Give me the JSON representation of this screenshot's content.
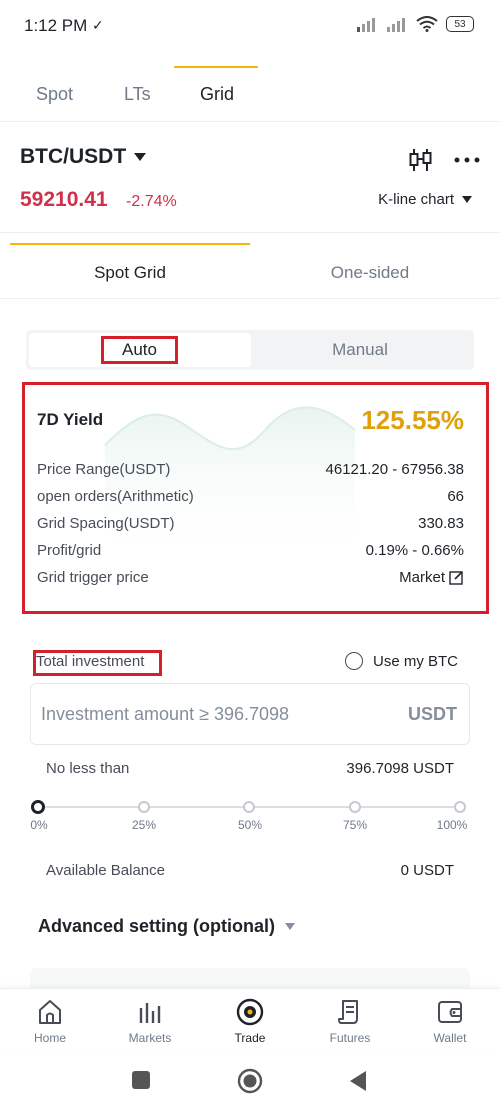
{
  "status_bar": {
    "time": "1:12 PM",
    "battery": "53"
  },
  "top_tabs": [
    "Spot",
    "LTs",
    "Grid"
  ],
  "pair": {
    "name": "BTC/USDT",
    "price": "59210.41",
    "change": "-2.74%",
    "kline_label": "K-line chart"
  },
  "sub_tabs": [
    "Spot Grid",
    "One-sided"
  ],
  "mode": {
    "auto": "Auto",
    "manual": "Manual"
  },
  "yield_card": {
    "title": "7D Yield",
    "value": "125.55%",
    "rows": [
      {
        "label": "Price Range(USDT)",
        "value": "46121.20 - 67956.38"
      },
      {
        "label": "open orders(Arithmetic)",
        "value": "66"
      },
      {
        "label": "Grid Spacing(USDT)",
        "value": "330.83"
      },
      {
        "label": "Profit/grid",
        "value": "0.19% - 0.66%"
      },
      {
        "label": "Grid trigger price",
        "value": "Market"
      }
    ]
  },
  "investment": {
    "label": "Total investment",
    "use_btc": "Use my BTC",
    "placeholder": "Investment amount  ≥ 396.7098",
    "unit": "USDT",
    "no_less_than_label": "No less than",
    "no_less_than_value": "396.7098 USDT",
    "slider_ticks": [
      "0%",
      "25%",
      "50%",
      "75%",
      "100%"
    ],
    "slider_value_percent": 0,
    "available_label": "Available Balance",
    "available_value": "0 USDT"
  },
  "advanced": {
    "label": "Advanced setting (optional)"
  },
  "bottom_nav": [
    {
      "label": "Home",
      "icon": "home-icon"
    },
    {
      "label": "Markets",
      "icon": "markets-icon"
    },
    {
      "label": "Trade",
      "icon": "trade-icon"
    },
    {
      "label": "Futures",
      "icon": "futures-icon"
    },
    {
      "label": "Wallet",
      "icon": "wallet-icon"
    }
  ],
  "colors": {
    "accent": "#f0b90b",
    "down": "#cf304a",
    "yield": "#e0a00b",
    "highlight": "#d3202a"
  }
}
